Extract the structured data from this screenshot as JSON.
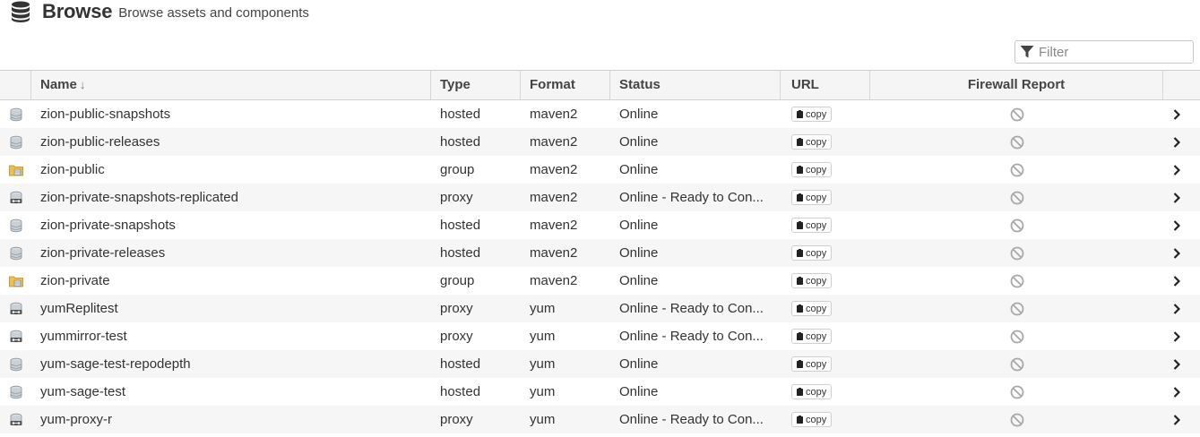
{
  "header": {
    "title": "Browse",
    "subtitle": "Browse assets and components"
  },
  "filter": {
    "placeholder": "Filter"
  },
  "table": {
    "columns": {
      "name": "Name",
      "type": "Type",
      "format": "Format",
      "status": "Status",
      "url": "URL",
      "firewall": "Firewall Report"
    },
    "sort_column": "name",
    "sort_direction": "desc",
    "copy_label": "copy",
    "rows": [
      {
        "icon": "hosted-repository-icon",
        "name": "zion-public-snapshots",
        "type": "hosted",
        "format": "maven2",
        "status": "Online"
      },
      {
        "icon": "hosted-repository-icon",
        "name": "zion-public-releases",
        "type": "hosted",
        "format": "maven2",
        "status": "Online"
      },
      {
        "icon": "group-repository-icon",
        "name": "zion-public",
        "type": "group",
        "format": "maven2",
        "status": "Online"
      },
      {
        "icon": "proxy-repository-icon",
        "name": "zion-private-snapshots-replicated",
        "type": "proxy",
        "format": "maven2",
        "status": "Online - Ready to Con..."
      },
      {
        "icon": "hosted-repository-icon",
        "name": "zion-private-snapshots",
        "type": "hosted",
        "format": "maven2",
        "status": "Online"
      },
      {
        "icon": "hosted-repository-icon",
        "name": "zion-private-releases",
        "type": "hosted",
        "format": "maven2",
        "status": "Online"
      },
      {
        "icon": "group-repository-icon",
        "name": "zion-private",
        "type": "group",
        "format": "maven2",
        "status": "Online"
      },
      {
        "icon": "proxy-repository-icon",
        "name": "yumReplitest",
        "type": "proxy",
        "format": "yum",
        "status": "Online - Ready to Con..."
      },
      {
        "icon": "proxy-repository-icon",
        "name": "yummirror-test",
        "type": "proxy",
        "format": "yum",
        "status": "Online - Ready to Con..."
      },
      {
        "icon": "hosted-repository-icon",
        "name": "yum-sage-test-repodepth",
        "type": "hosted",
        "format": "yum",
        "status": "Online"
      },
      {
        "icon": "hosted-repository-icon",
        "name": "yum-sage-test",
        "type": "hosted",
        "format": "yum",
        "status": "Online"
      },
      {
        "icon": "proxy-repository-icon",
        "name": "yum-proxy-r",
        "type": "proxy",
        "format": "yum",
        "status": "Online - Ready to Con..."
      }
    ]
  },
  "colors": {
    "header_bg": "#f5f5f5",
    "row_alt_bg": "#f6f6f6",
    "group_folder": "#f0c04a",
    "disabled_icon": "#a8a8a8"
  }
}
